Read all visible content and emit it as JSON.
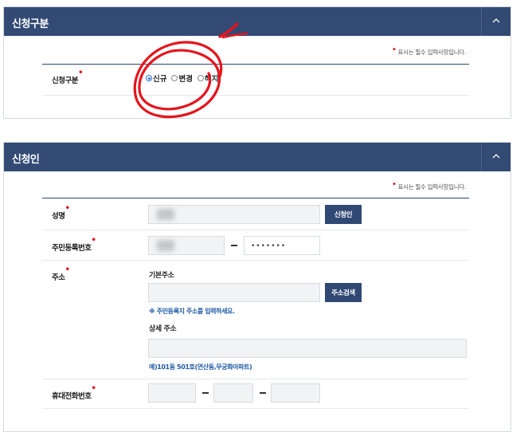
{
  "section1": {
    "title": "신청구분",
    "required_note": "표시는 필수 입력사항입니다.",
    "field_label": "신청구분",
    "options": [
      {
        "label": "신규",
        "selected": true
      },
      {
        "label": "변경",
        "selected": false
      },
      {
        "label": "해지",
        "selected": false
      }
    ]
  },
  "section2": {
    "title": "신청인",
    "required_note": "표시는 필수 입력사항입니다.",
    "name_label": "성명",
    "applicant_button": "신청인",
    "rrn_label": "주민등록번호",
    "rrn_back_masked": "•••••••",
    "address_label": "주소",
    "basic_address_label": "기본주소",
    "address_search_button": "주소검색",
    "address_hint": "※ 주민등록지 주소를 입력하세요.",
    "detail_address_label": "상세 주소",
    "detail_address_hint": "예)101동 501호(연산동,무궁화아파트)",
    "phone_label": "휴대전화번호"
  },
  "icons": {
    "collapse": "chevron-up-icon",
    "annotation": "red-circle-annotation"
  },
  "colors": {
    "header": "#324a74",
    "button": "#304874",
    "required": "#e60012",
    "hint": "#1f5ba8",
    "radio_selected": "#2c6ed6",
    "annotation": "#e5141c"
  }
}
